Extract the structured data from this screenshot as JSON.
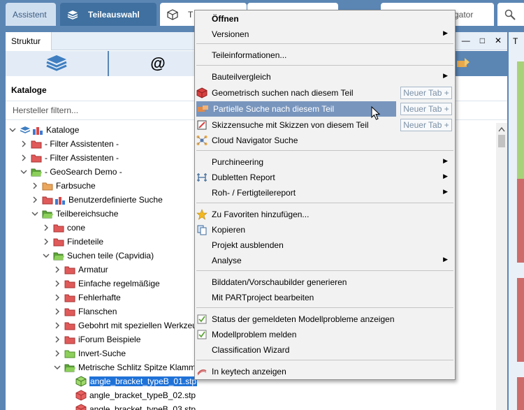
{
  "tabs": [
    {
      "label": "Assistent"
    },
    {
      "label": "Teileauswahl"
    },
    {
      "label": "T"
    },
    {
      "label": ""
    },
    {
      "label": "gator"
    },
    {
      "label": ""
    }
  ],
  "panel": {
    "tab_label": "Struktur",
    "catalogs_title": "Kataloge",
    "filter_placeholder": "Hersteller filtern...",
    "at_symbol": "@"
  },
  "right_panel": {
    "tab_label": "T"
  },
  "tree": [
    {
      "label": "Kataloge"
    },
    {
      "label": "- Filter Assistenten -"
    },
    {
      "label": "- Filter Assistenten -"
    },
    {
      "label": "- GeoSearch Demo -"
    },
    {
      "label": "Farbsuche"
    },
    {
      "label": "Benutzerdefinierte Suche"
    },
    {
      "label": "Teilbereichsuche"
    },
    {
      "label": "cone"
    },
    {
      "label": "Findeteile"
    },
    {
      "label": "Suchen teile (Capvidia)"
    },
    {
      "label": "Armatur"
    },
    {
      "label": "Einfache regelmäßige"
    },
    {
      "label": "Fehlerhafte"
    },
    {
      "label": "Flanschen"
    },
    {
      "label": "Gebohrt mit speziellen Werkzeu"
    },
    {
      "label": "iForum Beispiele"
    },
    {
      "label": "Invert-Suche"
    },
    {
      "label": "Metrische Schlitz Spitze Klamm"
    },
    {
      "label": "angle_bracket_typeB_01.stp"
    },
    {
      "label": "angle_bracket_typeB_02.stp"
    },
    {
      "label": "angle_bracket_typeB_03.stp"
    }
  ],
  "menu": {
    "items": [
      {
        "label": "Öffnen"
      },
      {
        "label": "Versionen"
      },
      {
        "label": "Teileinformationen..."
      },
      {
        "label": "Bauteilvergleich"
      },
      {
        "label": "Geometrisch suchen nach diesem Teil",
        "newtab": "Neuer Tab +"
      },
      {
        "label": "Partielle Suche nach diesem Teil",
        "newtab": "Neuer Tab +"
      },
      {
        "label": "Skizzensuche mit Skizzen von diesem Teil",
        "newtab": "Neuer Tab +"
      },
      {
        "label": "Cloud Navigator Suche"
      },
      {
        "label": "Purchineering"
      },
      {
        "label": "Dubletten Report"
      },
      {
        "label": "Roh- / Fertigteilereport"
      },
      {
        "label": "Zu Favoriten hinzufügen..."
      },
      {
        "label": "Kopieren"
      },
      {
        "label": "Projekt ausblenden"
      },
      {
        "label": "Analyse"
      },
      {
        "label": "Bilddaten/Vorschaubilder generieren"
      },
      {
        "label": "Mit PARTproject bearbeiten"
      },
      {
        "label": "Status der gemeldeten Modellprobleme anzeigen"
      },
      {
        "label": "Modellproblem melden"
      },
      {
        "label": "Classification Wizard"
      },
      {
        "label": "In keytech anzeigen"
      }
    ]
  },
  "colors": {
    "accent": "#5b86b4",
    "active_tab": "#3f709f",
    "selection": "#1f72d8",
    "menu_highlight": "#7895bd",
    "folder_red": "#e05a5a",
    "folder_green": "#8ccf5a",
    "folder_orange": "#eba75e"
  },
  "icons": {
    "tab_teileauswahl": "stack-icon",
    "tab_third": "cube-icon",
    "tab_search": "magnifier-icon",
    "window_buttons": [
      "minimize-icon",
      "maximize-icon",
      "close-icon"
    ]
  }
}
